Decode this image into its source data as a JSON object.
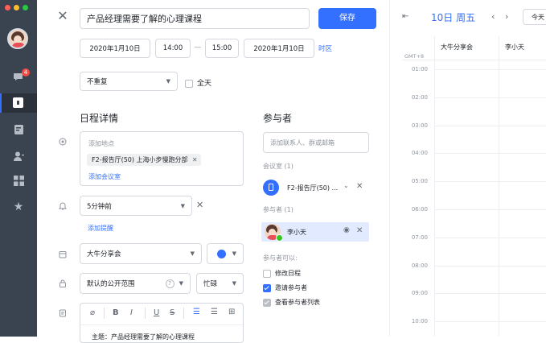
{
  "titlebar": {
    "event_title": "产品经理需要了解的心理课程",
    "save_label": "保存"
  },
  "time": {
    "start_date": "2020年1月10日",
    "start_time": "14:00",
    "dash": "—",
    "end_time": "15:00",
    "end_date": "2020年1月10日",
    "timezone_link": "时区"
  },
  "repeat": {
    "value": "不重复",
    "all_day_label": "全天"
  },
  "details": {
    "title": "日程详情",
    "location_placeholder": "添加地点",
    "room_chip": "F2-报告厅(50) 上海小步慢跑分部",
    "add_room_link": "添加会议室",
    "reminder_value": "5分钟前",
    "add_reminder_link": "添加提醒",
    "calendar_value": "大牛分享会",
    "visibility_value": "默认的公开范围",
    "busy_value": "忙碌",
    "editor_preview": "主题：产品经理需要了解的心理课程",
    "editor_tools": [
      "附件",
      "B",
      "I",
      "U",
      "S",
      "有序列表",
      "无序列表",
      "表格"
    ]
  },
  "participants": {
    "title": "参与者",
    "search_placeholder": "添加联系人、群或邮箱",
    "rooms_label": "会议室 (1)",
    "room_item": "F2-报告厅(50) ...",
    "people_label": "参与者 (1)",
    "person_name": "李小天",
    "perm_label": "参与者可以:",
    "perms": [
      {
        "label": "修改日程",
        "checked": false
      },
      {
        "label": "邀请参与者",
        "checked": true
      },
      {
        "label": "查看参与者列表",
        "checked": true
      }
    ]
  },
  "calendar": {
    "date_title": "10日 周五",
    "today_btn": "今天",
    "timezone": "GMT+8",
    "columns": [
      "大牛分享会",
      "李小天"
    ],
    "hours": [
      "01:00",
      "02:00",
      "03:00",
      "04:00",
      "05:00",
      "06:00",
      "07:00",
      "08:00",
      "09:00",
      "10:00"
    ]
  },
  "rail": {
    "badge_count": "4"
  },
  "colors": {
    "accent": "#3370ff",
    "rail_bg": "#3a4350",
    "selected_bg": "#e1eaff"
  }
}
